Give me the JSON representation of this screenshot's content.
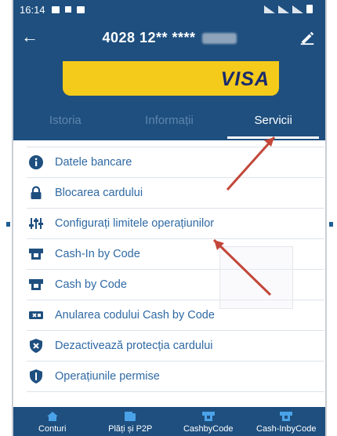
{
  "status_bar": {
    "time": "16:14"
  },
  "header": {
    "card_number": "4028 12** ****",
    "card_brand": "VISA"
  },
  "tabs": [
    {
      "label": "Istoria",
      "active": false
    },
    {
      "label": "Informații",
      "active": false
    },
    {
      "label": "Servicii",
      "active": true
    }
  ],
  "services": [
    {
      "label": "Datele bancare",
      "icon": "info-icon"
    },
    {
      "label": "Blocarea cardului",
      "icon": "lock-icon"
    },
    {
      "label": "Configurați limitele operațiunilor",
      "icon": "sliders-icon"
    },
    {
      "label": "Cash-In by Code",
      "icon": "cash-in-icon"
    },
    {
      "label": "Cash by Code",
      "icon": "cash-out-icon"
    },
    {
      "label": "Anularea codului Cash by Code",
      "icon": "cancel-code-icon"
    },
    {
      "label": "Dezactivează protecția cardului",
      "icon": "shield-x-icon"
    },
    {
      "label": "Operațiunile permise",
      "icon": "shield-icon"
    }
  ],
  "bottom_nav": [
    {
      "label": "Conturi",
      "icon": "home-icon"
    },
    {
      "label": "Plăți și P2P",
      "icon": "wallet-icon"
    },
    {
      "label": "CashbyCode",
      "icon": "cash-out-icon"
    },
    {
      "label": "Cash-InbyCode",
      "icon": "cash-in-icon"
    }
  ],
  "colors": {
    "primary": "#1e4f7f",
    "accent_text": "#2f69a3",
    "card_yellow": "#f4ca1b",
    "visa_blue": "#1a2b6d",
    "annotation_arrow": "#c2473a"
  }
}
